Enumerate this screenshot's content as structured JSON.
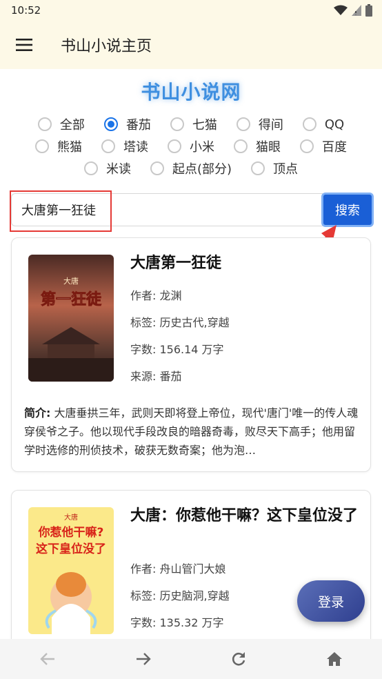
{
  "status_bar": {
    "time": "10:52"
  },
  "app_bar": {
    "title": "书山小说主页"
  },
  "site": {
    "title": "书山小说网"
  },
  "sources": {
    "row1": [
      {
        "label": "全部",
        "checked": false
      },
      {
        "label": "番茄",
        "checked": true
      },
      {
        "label": "七猫",
        "checked": false
      },
      {
        "label": "得间",
        "checked": false
      },
      {
        "label": "QQ",
        "checked": false
      }
    ],
    "row2": [
      {
        "label": "熊猫",
        "checked": false
      },
      {
        "label": "塔读",
        "checked": false
      },
      {
        "label": "小米",
        "checked": false
      },
      {
        "label": "猫眼",
        "checked": false
      },
      {
        "label": "百度",
        "checked": false
      }
    ],
    "row3": [
      {
        "label": "米读",
        "checked": false
      },
      {
        "label": "起点(部分)",
        "checked": false
      },
      {
        "label": "顶点",
        "checked": false
      }
    ]
  },
  "search": {
    "value": "大唐第一狂徒",
    "button_label": "搜索"
  },
  "books": [
    {
      "title": "大唐第一狂徒",
      "author": "作者: 龙渊",
      "tags": "标签: 历史古代,穿越",
      "words": "字数: 156.14 万字",
      "source": "来源: 番茄",
      "intro_label": "简介:",
      "intro": "大唐垂拱三年，武则天即将登上帝位，现代'唐门'唯一的传人魂穿侯爷之子。他以现代手段改良的暗器奇毒，败尽天下高手；他用留学时选修的刑侦技术，破获无数奇案；他为泡…",
      "cover_text": "第一狂徒",
      "cover_small": "大唐"
    },
    {
      "title": "大唐：你惹他干嘛？这下皇位没了",
      "author": "作者: 舟山管门大娘",
      "tags": "标签: 历史脑洞,穿越",
      "words": "字数: 135.32 万字",
      "cover_text1": "你惹他干嘛?",
      "cover_text2": "这下皇位没了",
      "cover_small": "大唐"
    }
  ],
  "fab": {
    "label": "登录"
  },
  "icons": {
    "menu": "menu-icon",
    "back": "arrow-left-icon",
    "forward": "arrow-right-icon",
    "refresh": "refresh-icon",
    "home": "home-icon"
  }
}
